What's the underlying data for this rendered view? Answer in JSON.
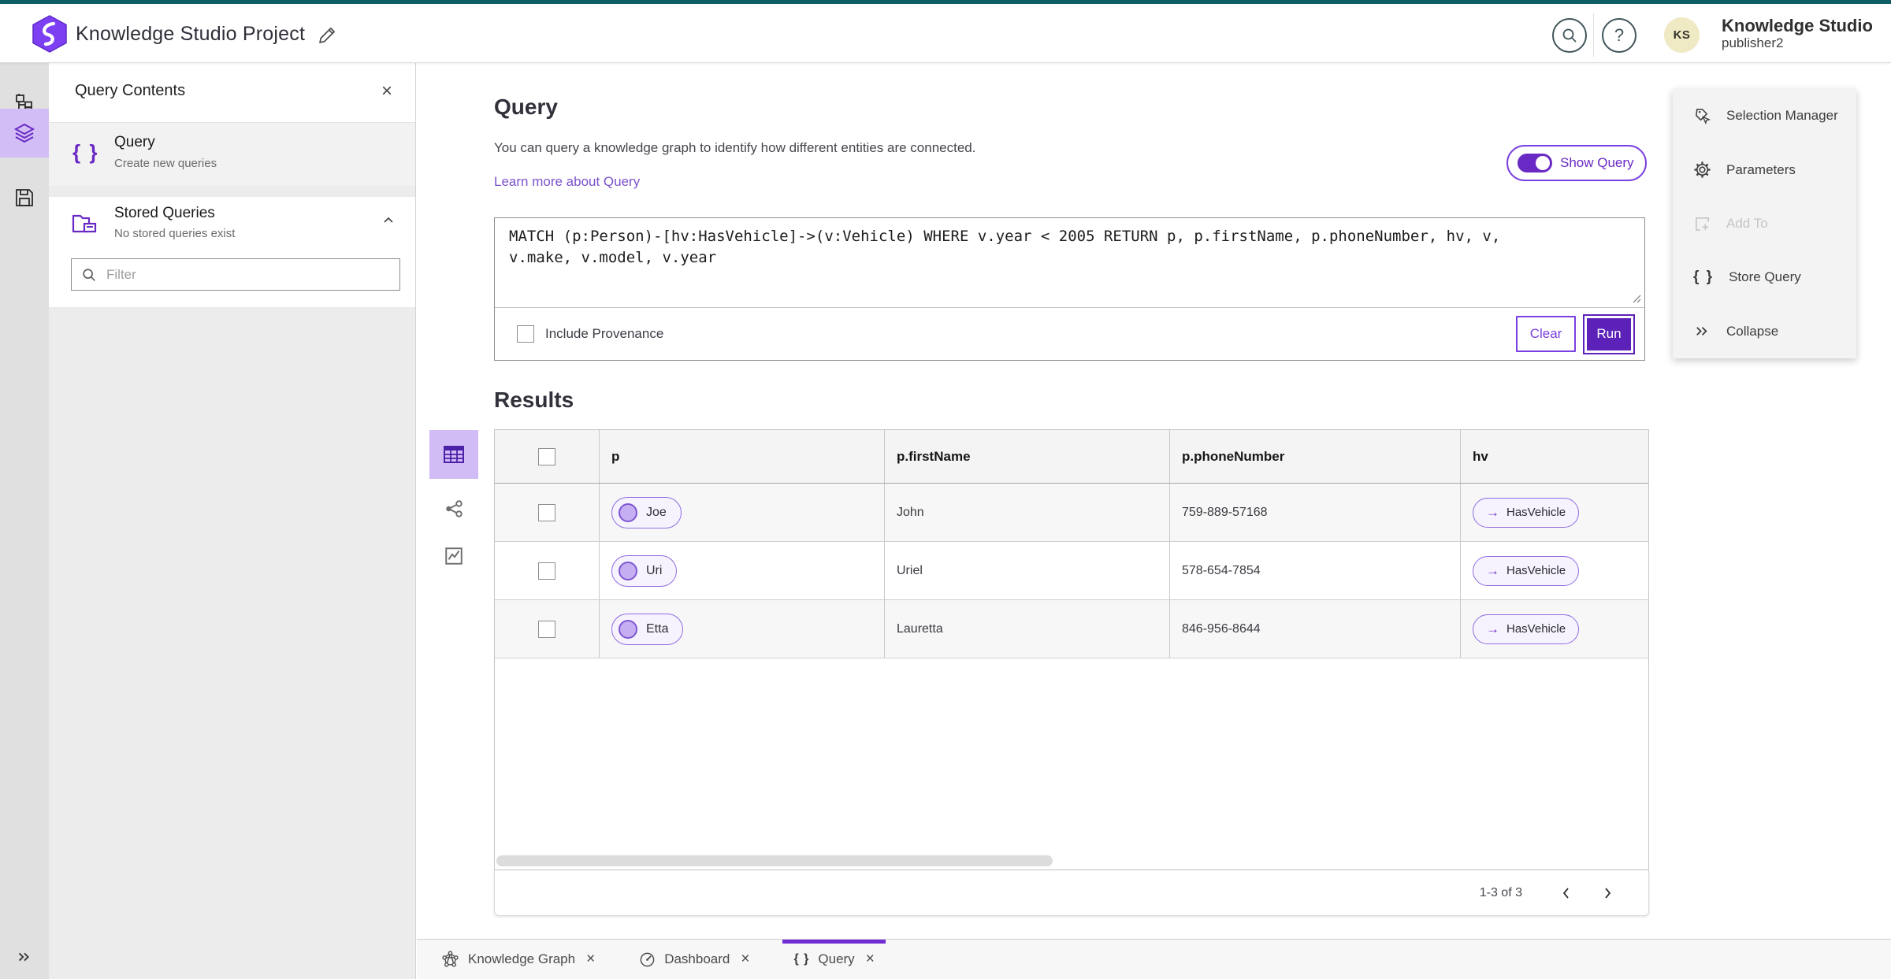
{
  "app": {
    "title": "Knowledge Studio Project",
    "brand": "Knowledge Studio",
    "user": "publisher2",
    "avatar_initials": "KS"
  },
  "colors": {
    "accent_purple": "#6929c4",
    "light_purple_selection": "#d3bdf7",
    "teal_strip": "#0f5e66",
    "run_button": "#5b21b8",
    "link_purple": "#7a52cc"
  },
  "sidebar": {
    "panel_title": "Query Contents",
    "query_item": {
      "title": "Query",
      "subtitle": "Create new queries"
    },
    "stored": {
      "title": "Stored Queries",
      "subtitle": "No stored queries exist"
    },
    "filter_placeholder": "Filter"
  },
  "main": {
    "title": "Query",
    "description": "You can query a knowledge graph to identify how different entities are connected.",
    "link": "Learn more about Query",
    "toggle_label": "Show Query",
    "query_text": "MATCH (p:Person)-[hv:HasVehicle]->(v:Vehicle) WHERE v.year < 2005 RETURN p, p.firstName, p.phoneNumber, hv, v, v.make, v.model, v.year",
    "include_provenance": "Include Provenance",
    "clear_label": "Clear",
    "run_label": "Run",
    "results_title": "Results"
  },
  "table": {
    "columns": [
      "p",
      "p.firstName",
      "p.phoneNumber",
      "hv"
    ],
    "rows": [
      {
        "p": "Joe",
        "firstName": "John",
        "phone": "759-889-57168",
        "hv": "HasVehicle",
        "hv_arrow": "→"
      },
      {
        "p": "Uri",
        "firstName": "Uriel",
        "phone": "578-654-7854",
        "hv": "HasVehicle",
        "hv_arrow": "→"
      },
      {
        "p": "Etta",
        "firstName": "Lauretta",
        "phone": "846-956-8644",
        "hv": "HasVehicle",
        "hv_arrow": "→"
      }
    ],
    "pagination": "1-3 of 3"
  },
  "right_panel": {
    "items": [
      {
        "label": "Selection Manager"
      },
      {
        "label": "Parameters"
      },
      {
        "label": "Add To"
      },
      {
        "label": "Store Query",
        "icon_glyph": "{ }"
      },
      {
        "label": "Collapse"
      }
    ]
  },
  "tabs": [
    {
      "label": "Knowledge Graph",
      "close": "×"
    },
    {
      "label": "Dashboard",
      "close": "×"
    },
    {
      "label": "Query",
      "close": "×",
      "icon_glyph": "{ }"
    }
  ],
  "sidebar_query_icon_glyph": "{ }",
  "misc": {
    "close_glyph": "×"
  }
}
